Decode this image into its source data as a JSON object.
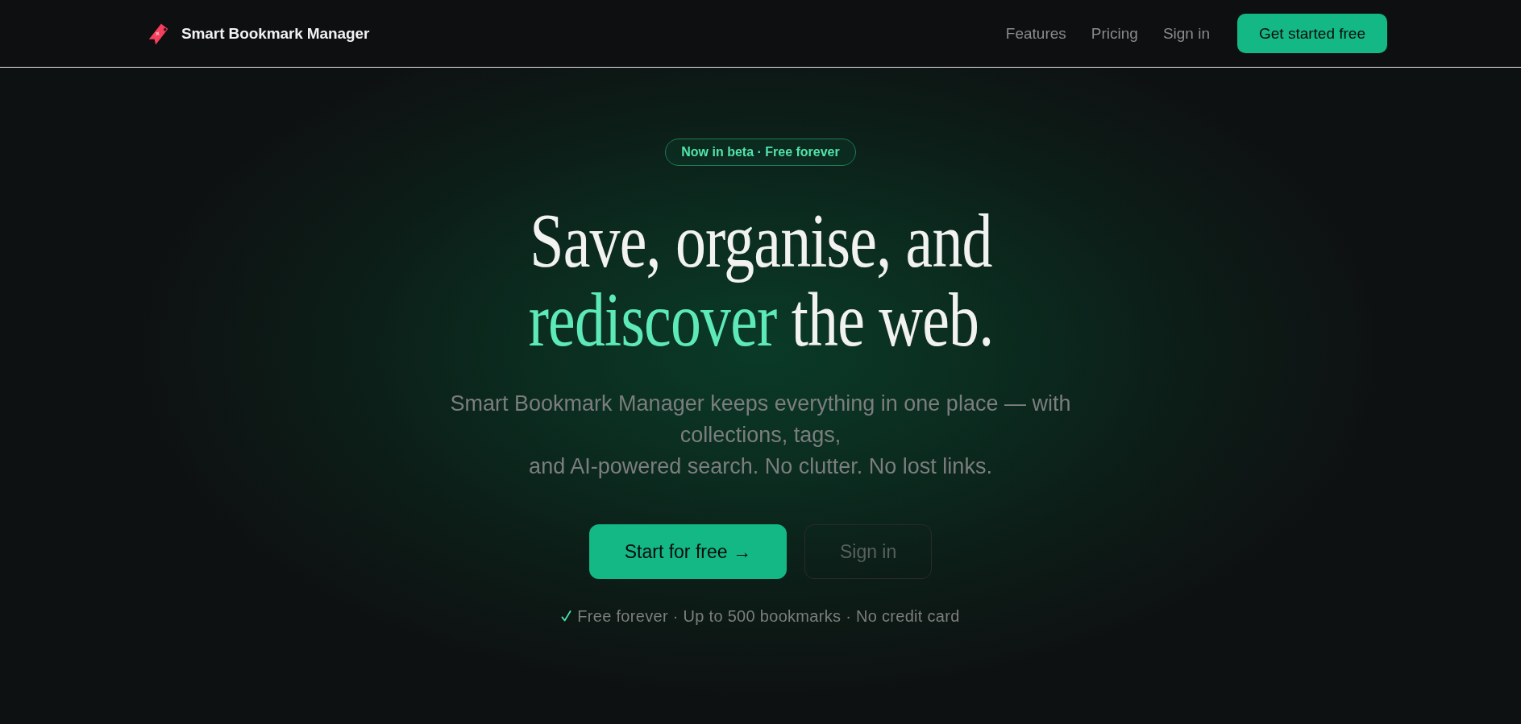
{
  "header": {
    "brand": "Smart Bookmark Manager",
    "nav": [
      "Features",
      "Pricing",
      "Sign in"
    ],
    "cta": "Get started free"
  },
  "hero": {
    "badge": "Now in beta · Free forever",
    "headline": [
      {
        "text": "Save, organise, and",
        "accent": false
      },
      {
        "text": "rediscover",
        "accent": true
      },
      {
        "text": "the web.",
        "accent": false
      }
    ],
    "subtitle": "Smart Bookmark Manager keeps everything in one place — with collections, tags,\nand AI-powered search. No clutter. No lost links.",
    "buttons": [
      {
        "label": "Start for free →",
        "kind": "primary"
      },
      {
        "label": "Sign in",
        "kind": "ghost"
      }
    ],
    "note": "Free forever · Up to 500 bookmarks · No credit card"
  }
}
